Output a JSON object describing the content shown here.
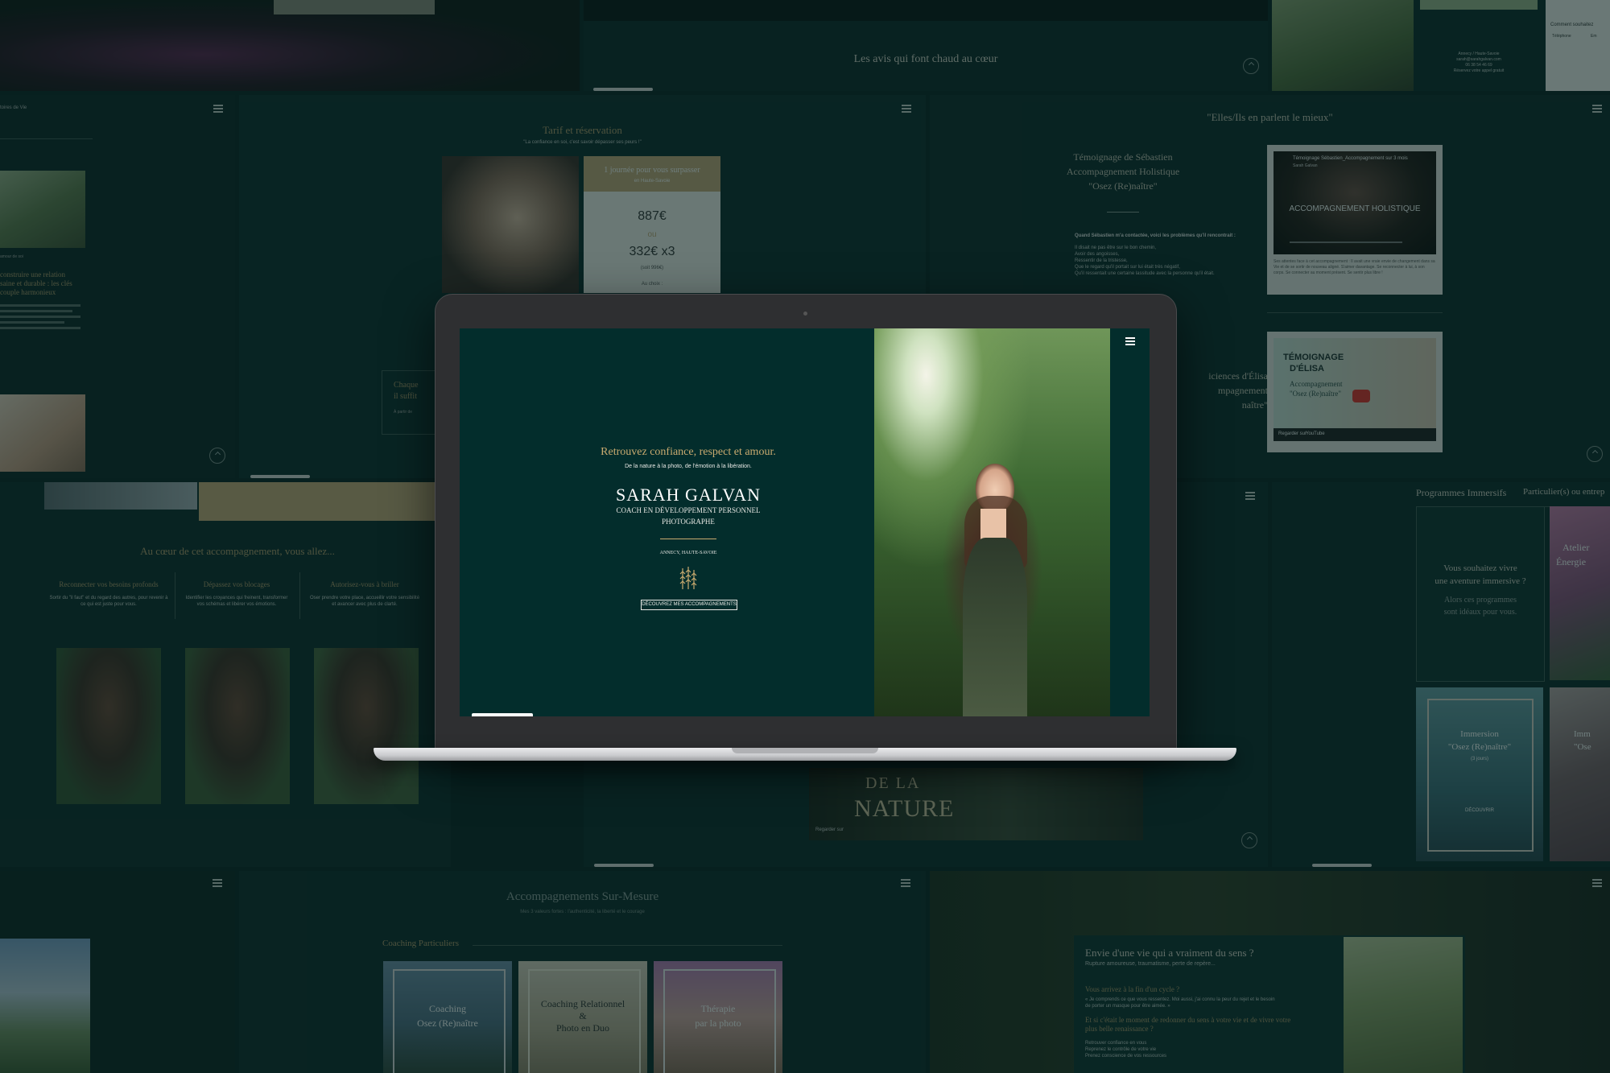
{
  "hero": {
    "tagline": "Retrouvez confiance, respect et amour.",
    "subline": "De la nature à la photo, de l'émotion à la libération.",
    "name": "SARAH GALVAN",
    "role1": "COACH EN DÉVELOPPEMENT PERSONNEL",
    "role2": "PHOTOGRAPHE",
    "location": "ANNECY, HAUTE-SAVOIE",
    "cta": "DÉCOUVREZ MES ACCOMPAGNEMENTS"
  },
  "avis": {
    "title": "Les avis qui font chaud au cœur"
  },
  "tarif": {
    "title": "Tarif et réservation",
    "quote": "\"La confiance en soi, c'est savoir dépasser ses peurs !\"",
    "card_title": "1 journée pour vous surpasser",
    "card_sub": "en Haute-Savoie",
    "price1": "887",
    "ou": "ou",
    "price2": "332",
    "times": "x3",
    "soit": "(soit 996€)",
    "achats": "Au choix :",
    "chaque": "Chaque",
    "il_suffit": "il suffit",
    "a_partir": "À partir de"
  },
  "temoignages": {
    "title": "\"Elles/Ils en parlent le mieux\"",
    "seb_title1": "Témoignage de Sébastien",
    "seb_title2": "Accompagnement Holistique",
    "seb_title3": "\"Osez (Re)naître\"",
    "seb_intro": "Quand Sébastien m'a contactée, voici les problèmes qu'il rencontrait :",
    "seb_lines": [
      "Il disait ne pas être sur le bon chemin,",
      "Avoir des angoisses,",
      "Ressentir de la tristesse,",
      "Que le regard qu'il portait sur lui était très négatif,",
      "Qu'il ressentait une certaine lassitude avec la personne qu'il était."
    ],
    "video1_title": "Témoignage Sébastien_Accompagnement sur 3 mois",
    "video1_channel": "Sarah Galvan",
    "video1_overlay": "ACCOMPAGNEMENT HOLISTIQUE",
    "video1_caption": "Ses attentes face à cet accompagnement : Il avait une vraie envie de changement dans sa Vie et de se sortir de nouveau aligné. S'aimer davantage. Se reconnecter à lui, à son corps. Se connecter au moment présent. Se sentir plus libre !",
    "elisa_title1": "iciences d'Élisa",
    "elisa_title2": "mpagnement",
    "elisa_title3": "naître\"",
    "video2_t1": "TÉMOIGNAGE",
    "video2_t2": "D'ÉLISA",
    "video2_t3": "Accompagnement",
    "video2_t4": "\"Osez (Re)naître\"",
    "video2_footer": "Regarder sur",
    "youtube": "YouTube"
  },
  "couple": {
    "heading1": "construire une relation",
    "heading2": "saine et durable : les clés",
    "heading3": "couple harmonieux",
    "small_label": "amour de soi",
    "nav_label": "toires de Vie"
  },
  "coeur": {
    "title": "Au cœur de cet accompagnement, vous allez...",
    "cols": [
      {
        "title": "Reconnecter vos besoins profonds",
        "text": "Sortir du \"il faut\" et du regard des autres, pour revenir à ce qui est juste pour vous."
      },
      {
        "title": "Dépassez vos blocages",
        "text": "Identifier les croyances qui freinent, transformer vos schémas et libérer vos émotions."
      },
      {
        "title": "Autorisez-vous à briller",
        "text": "Oser prendre votre place, accueillir votre sensibilité et avancer avec plus de clarté."
      }
    ]
  },
  "nature": {
    "line1": "DE LA",
    "line2": "NATURE",
    "footer": "Regarder sur"
  },
  "programmes": {
    "tab1": "Programmes Immersifs",
    "tab2": "Particulier(s) ou entrep",
    "card1_l1": "Vous souhaitez vivre",
    "card1_l2": "une aventure immersive ?",
    "card1_l3": "Alors ces programmes",
    "card1_l4": "sont idéaux pour vous.",
    "card2_l1": "Atelier",
    "card2_l2": "Énergie",
    "card3_l1": "Immersion",
    "card3_l2": "\"Osez (Re)naître\"",
    "card3_l3": "(3 jours)",
    "card3_l4": "DÉCOUVRIR",
    "card4_l1": "Imm",
    "card4_l2": "\"Ose"
  },
  "contact": {
    "label": "Comment souhaitez",
    "phone_label": "Téléphone",
    "email_label": "Em",
    "addr1": "Annecy / Haute-Savoie",
    "addr2": "sarah@sarahgalvan.com",
    "addr3": "06 38 54 46 69",
    "addr4": "Réservez votre appel gratuit"
  },
  "sur_mesure": {
    "title": "Accompagnements Sur-Mesure",
    "subtitle": "Mes 3 valeurs fortes : l'authenticité, la liberté et le courage",
    "section": "Coaching Particuliers",
    "card1_l1": "Coaching",
    "card1_l2": "Osez (Re)naître",
    "card2_l1": "Coaching Relationnel",
    "card2_l2": "&",
    "card2_l3": "Photo en Duo",
    "card3_l1": "Thérapie",
    "card3_l2": "par la photo"
  },
  "sens": {
    "title": "Envie d'une vie qui a vraiment du sens ?",
    "subtitle": "Rupture amoureuse, traumatisme, perte de repère...",
    "q1": "Vous arrivez à la fin d'un cycle ?",
    "q1_text": "« Je comprends ce que vous ressentez. Moi aussi, j'ai connu la peur du rejet et le besoin de porter un masque pour être aimée. »",
    "q2": "Et si c'était le moment de redonner du sens à votre vie et de vivre votre plus belle renaissance ?",
    "bullets": [
      "Retrouver confiance en vous",
      "Reprenez le contrôle de votre vie",
      "Prenez conscience de vos ressources"
    ]
  },
  "colors": {
    "bg": "#07201f",
    "panel": "#0b2927",
    "hero": "#032d2c",
    "gold": "#b39a6a",
    "cream": "#e3d0a8"
  }
}
